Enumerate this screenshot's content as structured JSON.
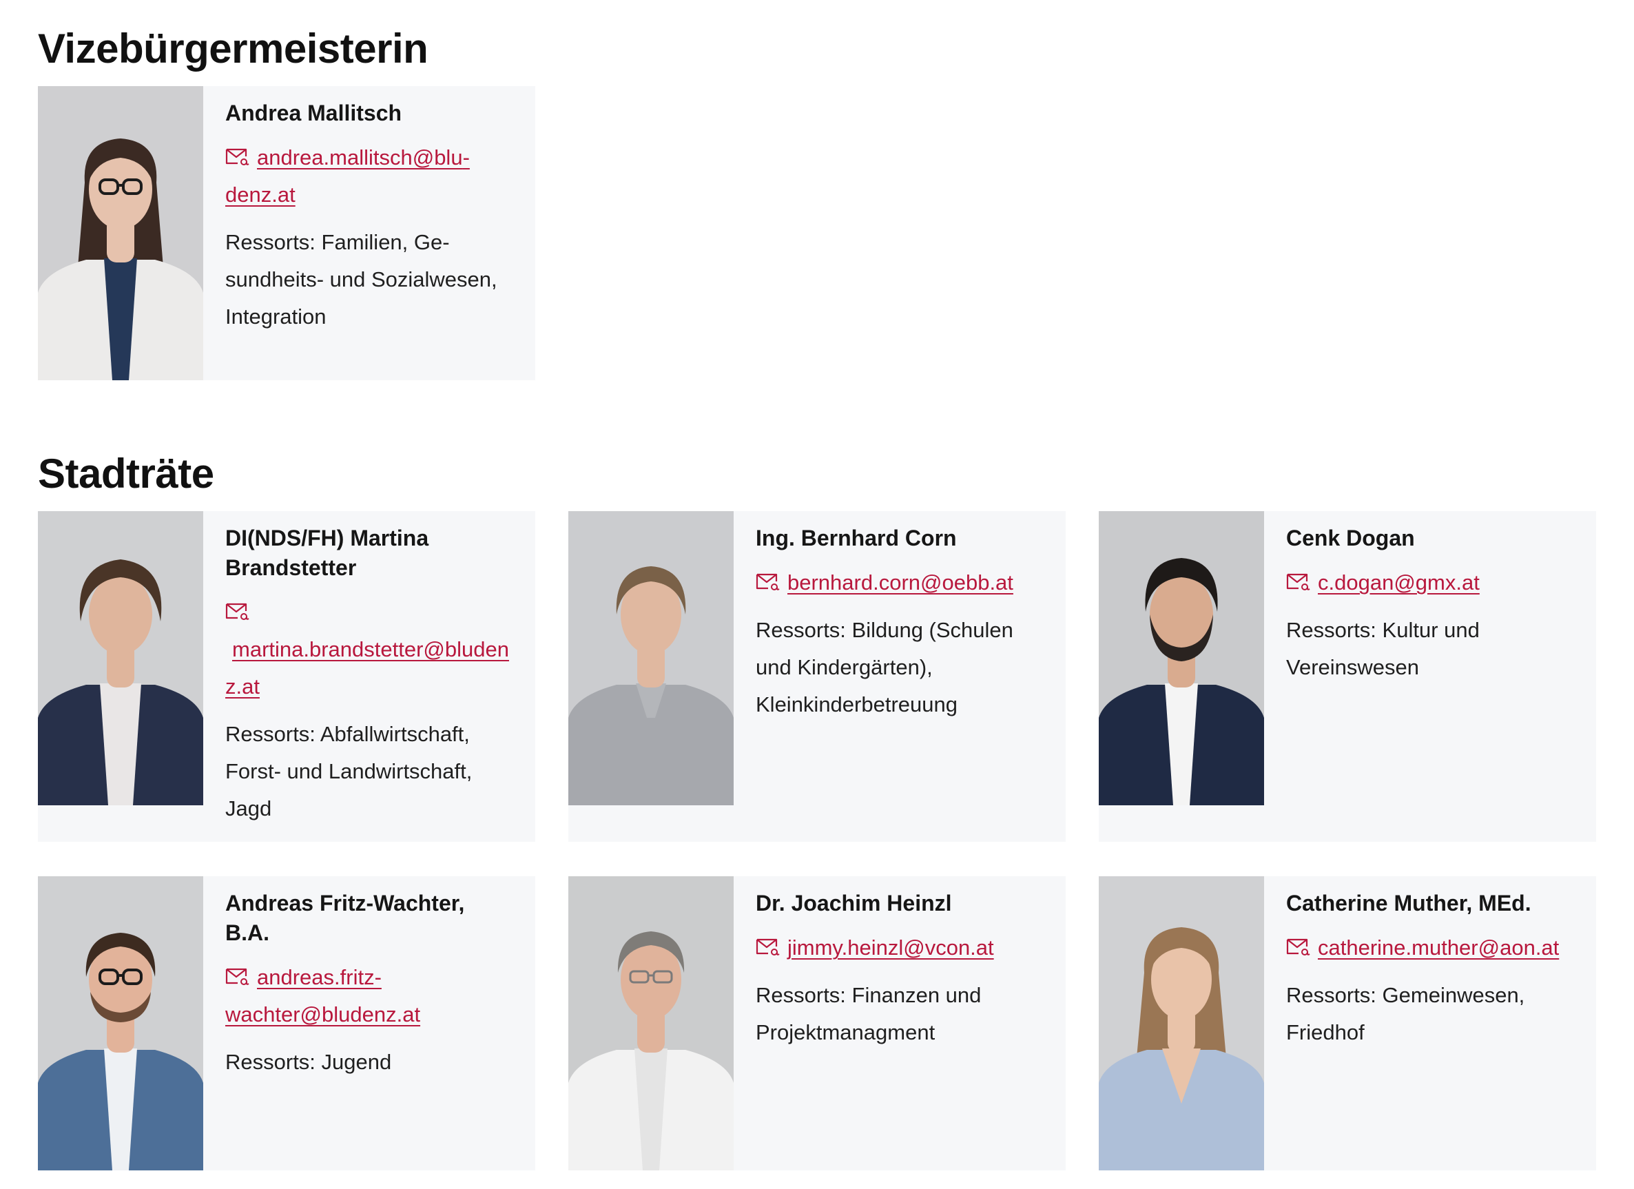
{
  "sections": [
    {
      "heading": "Vizebürgermeisterin",
      "members": [
        {
          "name": "Andrea Mallitsch",
          "email": "andrea.mallitsch@blu­denz.at",
          "ressorts": "Ressorts: Familien, Ge­sundheits- und Sozialwe­sen, Integration",
          "portrait": {
            "bg": "#cfcfd1",
            "skin": "#e6c2ad",
            "hair": "#3b2a23",
            "hair_long": "#3b2a23",
            "jacket": "#ecebea",
            "shirt": "#253858",
            "glasses": "#1c1c1c",
            "beard": "none"
          }
        }
      ]
    },
    {
      "heading": "Stadträte",
      "members": [
        {
          "name": "DI(NDS/FH) Martina Brandstetter",
          "email": "martina.brandstetter@bludenz.at",
          "ressorts": "Ressorts: Abfallwirtschaft, Forst- und Landwirtschaft, Jagd",
          "portrait": {
            "bg": "#cfd0d2",
            "skin": "#dfb59c",
            "hair": "#4a3527",
            "hair_long": "none",
            "jacket": "#27304a",
            "shirt": "#e9e6e6",
            "glasses": "none",
            "beard": "none"
          }
        },
        {
          "name": "Ing. Bernhard Corn",
          "email": "bernhard.corn@oeb­b.at",
          "ressorts": "Ressorts: Bildung (Schu­len und Kindergärten), Kleinkinderbetreuung",
          "portrait": {
            "bg": "#cbcccf",
            "skin": "#e0b8a0",
            "hair": "#7a6148",
            "hair_long": "none",
            "jacket": "#a6a8ad",
            "shirt": "#b4b6ba",
            "glasses": "none",
            "beard": "none"
          }
        },
        {
          "name": "Cenk Dogan",
          "email": "c.dogan@gmx.at",
          "ressorts": "Ressorts: Kultur und Vereinswesen",
          "portrait": {
            "bg": "#c9cacc",
            "skin": "#d9ab8f",
            "hair": "#1e1a18",
            "hair_long": "none",
            "jacket": "#1f2a44",
            "shirt": "#f4f4f4",
            "glasses": "none",
            "beard": "#2a2320"
          }
        },
        {
          "name": "Andreas Fritz-Wachter, B.A.",
          "email": "andreas.fritz-wachter@bludenz.at",
          "ressorts": "Ressorts: Jugend",
          "portrait": {
            "bg": "#cfd0d2",
            "skin": "#e2b39a",
            "hair": "#3d2b20",
            "hair_long": "none",
            "jacket": "#4d6f98",
            "shirt": "#eef1f4",
            "glasses": "#1b1b1b",
            "beard": "#6a4a36"
          }
        },
        {
          "name": "Dr. Joachim Heinzl",
          "email": "jimmy.heinzl@vcon.at",
          "ressorts": "Ressorts: Finanzen und Projektmanagment",
          "portrait": {
            "bg": "#cbcccd",
            "skin": "#e0b39b",
            "hair": "#7f7c78",
            "hair_long": "none",
            "jacket": "#f2f2f2",
            "shirt": "#e4e4e4",
            "glasses": "#7a7a7a",
            "beard": "none"
          }
        },
        {
          "name": "Catherine Muther, MEd.",
          "email": "catherine.muther@aon.at",
          "ressorts": "Ressorts: Gemeinwesen, Friedhof",
          "portrait": {
            "bg": "#d0d1d3",
            "skin": "#e9c3a9",
            "hair": "#9a7654",
            "hair_long": "#9a7654",
            "jacket": "#aebfd8",
            "shirt": "#e9c3a9",
            "glasses": "none",
            "beard": "none"
          }
        }
      ]
    }
  ],
  "theme": {
    "link_color": "#b8183d",
    "card_background": "#f6f7f9"
  }
}
